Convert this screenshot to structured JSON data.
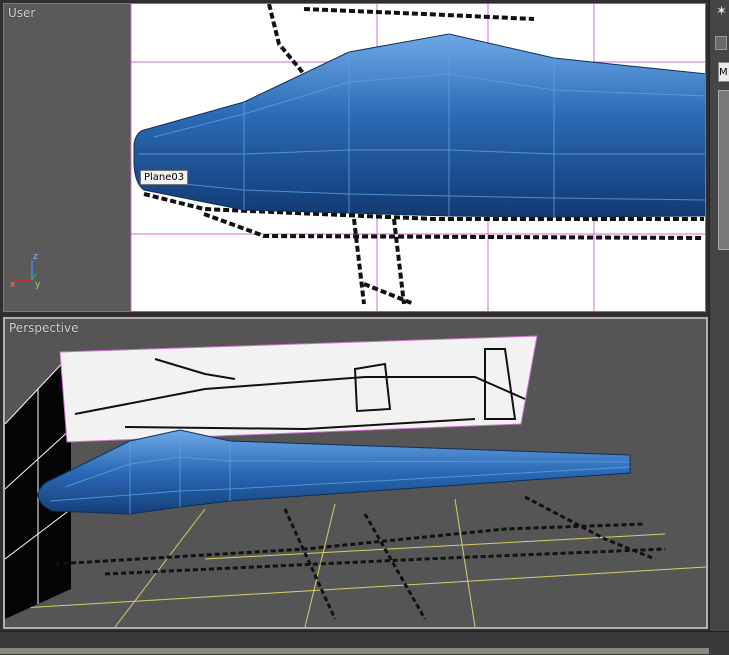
{
  "viewports": {
    "user": {
      "label": "User",
      "object_tag": "Plane03"
    },
    "perspective": {
      "label": "Perspective"
    }
  },
  "axis_gizmo": {
    "x": "x",
    "y": "y",
    "z": "z"
  },
  "command_panel": {
    "field_text": "M"
  },
  "colors": {
    "model": "#2a6ab5",
    "highlight": "#5f9fe2",
    "grid_line": "#d070d0",
    "ground_grid": "#d8cf6a"
  }
}
